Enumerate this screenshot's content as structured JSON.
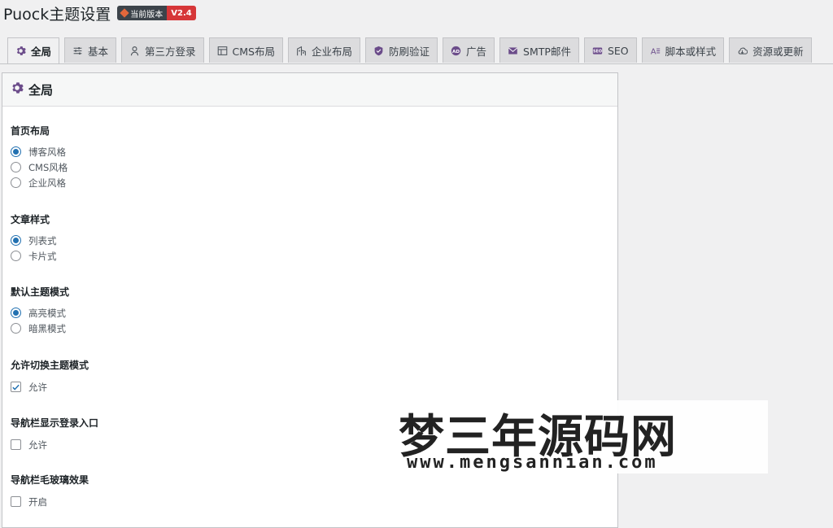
{
  "header": {
    "title": "Puock主题设置",
    "version_label": "当前版本",
    "version": "V2.4"
  },
  "tabs": [
    {
      "label": "全局",
      "icon": "gear-icon",
      "active": true
    },
    {
      "label": "基本",
      "icon": "sliders-icon",
      "active": false
    },
    {
      "label": "第三方登录",
      "icon": "user-lock-icon",
      "active": false
    },
    {
      "label": "CMS布局",
      "icon": "layout-icon",
      "active": false
    },
    {
      "label": "企业布局",
      "icon": "building-icon",
      "active": false
    },
    {
      "label": "防刷验证",
      "icon": "shield-icon",
      "active": false
    },
    {
      "label": "广告",
      "icon": "ad-icon",
      "active": false
    },
    {
      "label": "SMTP邮件",
      "icon": "mail-icon",
      "active": false
    },
    {
      "label": "SEO",
      "icon": "seo-icon",
      "active": false
    },
    {
      "label": "脚本或样式",
      "icon": "code-icon",
      "active": false
    },
    {
      "label": "资源或更新",
      "icon": "cloud-icon",
      "active": false
    }
  ],
  "panel": {
    "title": "全局",
    "sections": [
      {
        "label": "首页布局",
        "type": "radio",
        "options": [
          "博客风格",
          "CMS风格",
          "企业风格"
        ],
        "selected": 0
      },
      {
        "label": "文章样式",
        "type": "radio",
        "options": [
          "列表式",
          "卡片式"
        ],
        "selected": 0
      },
      {
        "label": "默认主题模式",
        "type": "radio",
        "options": [
          "高亮模式",
          "暗黑模式"
        ],
        "selected": 0
      },
      {
        "label": "允许切换主题模式",
        "type": "checkbox",
        "option": "允许",
        "checked": true
      },
      {
        "label": "导航栏显示登录入口",
        "type": "checkbox",
        "option": "允许",
        "checked": false
      },
      {
        "label": "导航栏毛玻璃效果",
        "type": "checkbox",
        "option": "开启",
        "checked": false
      }
    ]
  },
  "watermark": {
    "text": "梦三年源码网",
    "url": "www.mengsannian.com"
  },
  "colors": {
    "accent": "#2271b1",
    "badge_red": "#d63638",
    "badge_dark": "#3c434a"
  }
}
